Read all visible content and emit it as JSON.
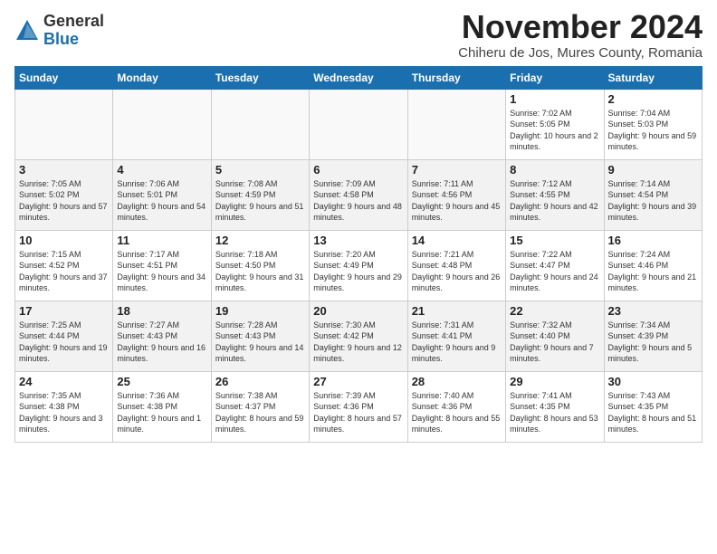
{
  "logo": {
    "general": "General",
    "blue": "Blue"
  },
  "title": "November 2024",
  "subtitle": "Chiheru de Jos, Mures County, Romania",
  "weekdays": [
    "Sunday",
    "Monday",
    "Tuesday",
    "Wednesday",
    "Thursday",
    "Friday",
    "Saturday"
  ],
  "weeks": [
    [
      {
        "day": "",
        "sunrise": "",
        "sunset": "",
        "daylight": ""
      },
      {
        "day": "",
        "sunrise": "",
        "sunset": "",
        "daylight": ""
      },
      {
        "day": "",
        "sunrise": "",
        "sunset": "",
        "daylight": ""
      },
      {
        "day": "",
        "sunrise": "",
        "sunset": "",
        "daylight": ""
      },
      {
        "day": "",
        "sunrise": "",
        "sunset": "",
        "daylight": ""
      },
      {
        "day": "1",
        "sunrise": "Sunrise: 7:02 AM",
        "sunset": "Sunset: 5:05 PM",
        "daylight": "Daylight: 10 hours and 2 minutes."
      },
      {
        "day": "2",
        "sunrise": "Sunrise: 7:04 AM",
        "sunset": "Sunset: 5:03 PM",
        "daylight": "Daylight: 9 hours and 59 minutes."
      }
    ],
    [
      {
        "day": "3",
        "sunrise": "Sunrise: 7:05 AM",
        "sunset": "Sunset: 5:02 PM",
        "daylight": "Daylight: 9 hours and 57 minutes."
      },
      {
        "day": "4",
        "sunrise": "Sunrise: 7:06 AM",
        "sunset": "Sunset: 5:01 PM",
        "daylight": "Daylight: 9 hours and 54 minutes."
      },
      {
        "day": "5",
        "sunrise": "Sunrise: 7:08 AM",
        "sunset": "Sunset: 4:59 PM",
        "daylight": "Daylight: 9 hours and 51 minutes."
      },
      {
        "day": "6",
        "sunrise": "Sunrise: 7:09 AM",
        "sunset": "Sunset: 4:58 PM",
        "daylight": "Daylight: 9 hours and 48 minutes."
      },
      {
        "day": "7",
        "sunrise": "Sunrise: 7:11 AM",
        "sunset": "Sunset: 4:56 PM",
        "daylight": "Daylight: 9 hours and 45 minutes."
      },
      {
        "day": "8",
        "sunrise": "Sunrise: 7:12 AM",
        "sunset": "Sunset: 4:55 PM",
        "daylight": "Daylight: 9 hours and 42 minutes."
      },
      {
        "day": "9",
        "sunrise": "Sunrise: 7:14 AM",
        "sunset": "Sunset: 4:54 PM",
        "daylight": "Daylight: 9 hours and 39 minutes."
      }
    ],
    [
      {
        "day": "10",
        "sunrise": "Sunrise: 7:15 AM",
        "sunset": "Sunset: 4:52 PM",
        "daylight": "Daylight: 9 hours and 37 minutes."
      },
      {
        "day": "11",
        "sunrise": "Sunrise: 7:17 AM",
        "sunset": "Sunset: 4:51 PM",
        "daylight": "Daylight: 9 hours and 34 minutes."
      },
      {
        "day": "12",
        "sunrise": "Sunrise: 7:18 AM",
        "sunset": "Sunset: 4:50 PM",
        "daylight": "Daylight: 9 hours and 31 minutes."
      },
      {
        "day": "13",
        "sunrise": "Sunrise: 7:20 AM",
        "sunset": "Sunset: 4:49 PM",
        "daylight": "Daylight: 9 hours and 29 minutes."
      },
      {
        "day": "14",
        "sunrise": "Sunrise: 7:21 AM",
        "sunset": "Sunset: 4:48 PM",
        "daylight": "Daylight: 9 hours and 26 minutes."
      },
      {
        "day": "15",
        "sunrise": "Sunrise: 7:22 AM",
        "sunset": "Sunset: 4:47 PM",
        "daylight": "Daylight: 9 hours and 24 minutes."
      },
      {
        "day": "16",
        "sunrise": "Sunrise: 7:24 AM",
        "sunset": "Sunset: 4:46 PM",
        "daylight": "Daylight: 9 hours and 21 minutes."
      }
    ],
    [
      {
        "day": "17",
        "sunrise": "Sunrise: 7:25 AM",
        "sunset": "Sunset: 4:44 PM",
        "daylight": "Daylight: 9 hours and 19 minutes."
      },
      {
        "day": "18",
        "sunrise": "Sunrise: 7:27 AM",
        "sunset": "Sunset: 4:43 PM",
        "daylight": "Daylight: 9 hours and 16 minutes."
      },
      {
        "day": "19",
        "sunrise": "Sunrise: 7:28 AM",
        "sunset": "Sunset: 4:43 PM",
        "daylight": "Daylight: 9 hours and 14 minutes."
      },
      {
        "day": "20",
        "sunrise": "Sunrise: 7:30 AM",
        "sunset": "Sunset: 4:42 PM",
        "daylight": "Daylight: 9 hours and 12 minutes."
      },
      {
        "day": "21",
        "sunrise": "Sunrise: 7:31 AM",
        "sunset": "Sunset: 4:41 PM",
        "daylight": "Daylight: 9 hours and 9 minutes."
      },
      {
        "day": "22",
        "sunrise": "Sunrise: 7:32 AM",
        "sunset": "Sunset: 4:40 PM",
        "daylight": "Daylight: 9 hours and 7 minutes."
      },
      {
        "day": "23",
        "sunrise": "Sunrise: 7:34 AM",
        "sunset": "Sunset: 4:39 PM",
        "daylight": "Daylight: 9 hours and 5 minutes."
      }
    ],
    [
      {
        "day": "24",
        "sunrise": "Sunrise: 7:35 AM",
        "sunset": "Sunset: 4:38 PM",
        "daylight": "Daylight: 9 hours and 3 minutes."
      },
      {
        "day": "25",
        "sunrise": "Sunrise: 7:36 AM",
        "sunset": "Sunset: 4:38 PM",
        "daylight": "Daylight: 9 hours and 1 minute."
      },
      {
        "day": "26",
        "sunrise": "Sunrise: 7:38 AM",
        "sunset": "Sunset: 4:37 PM",
        "daylight": "Daylight: 8 hours and 59 minutes."
      },
      {
        "day": "27",
        "sunrise": "Sunrise: 7:39 AM",
        "sunset": "Sunset: 4:36 PM",
        "daylight": "Daylight: 8 hours and 57 minutes."
      },
      {
        "day": "28",
        "sunrise": "Sunrise: 7:40 AM",
        "sunset": "Sunset: 4:36 PM",
        "daylight": "Daylight: 8 hours and 55 minutes."
      },
      {
        "day": "29",
        "sunrise": "Sunrise: 7:41 AM",
        "sunset": "Sunset: 4:35 PM",
        "daylight": "Daylight: 8 hours and 53 minutes."
      },
      {
        "day": "30",
        "sunrise": "Sunrise: 7:43 AM",
        "sunset": "Sunset: 4:35 PM",
        "daylight": "Daylight: 8 hours and 51 minutes."
      }
    ]
  ]
}
